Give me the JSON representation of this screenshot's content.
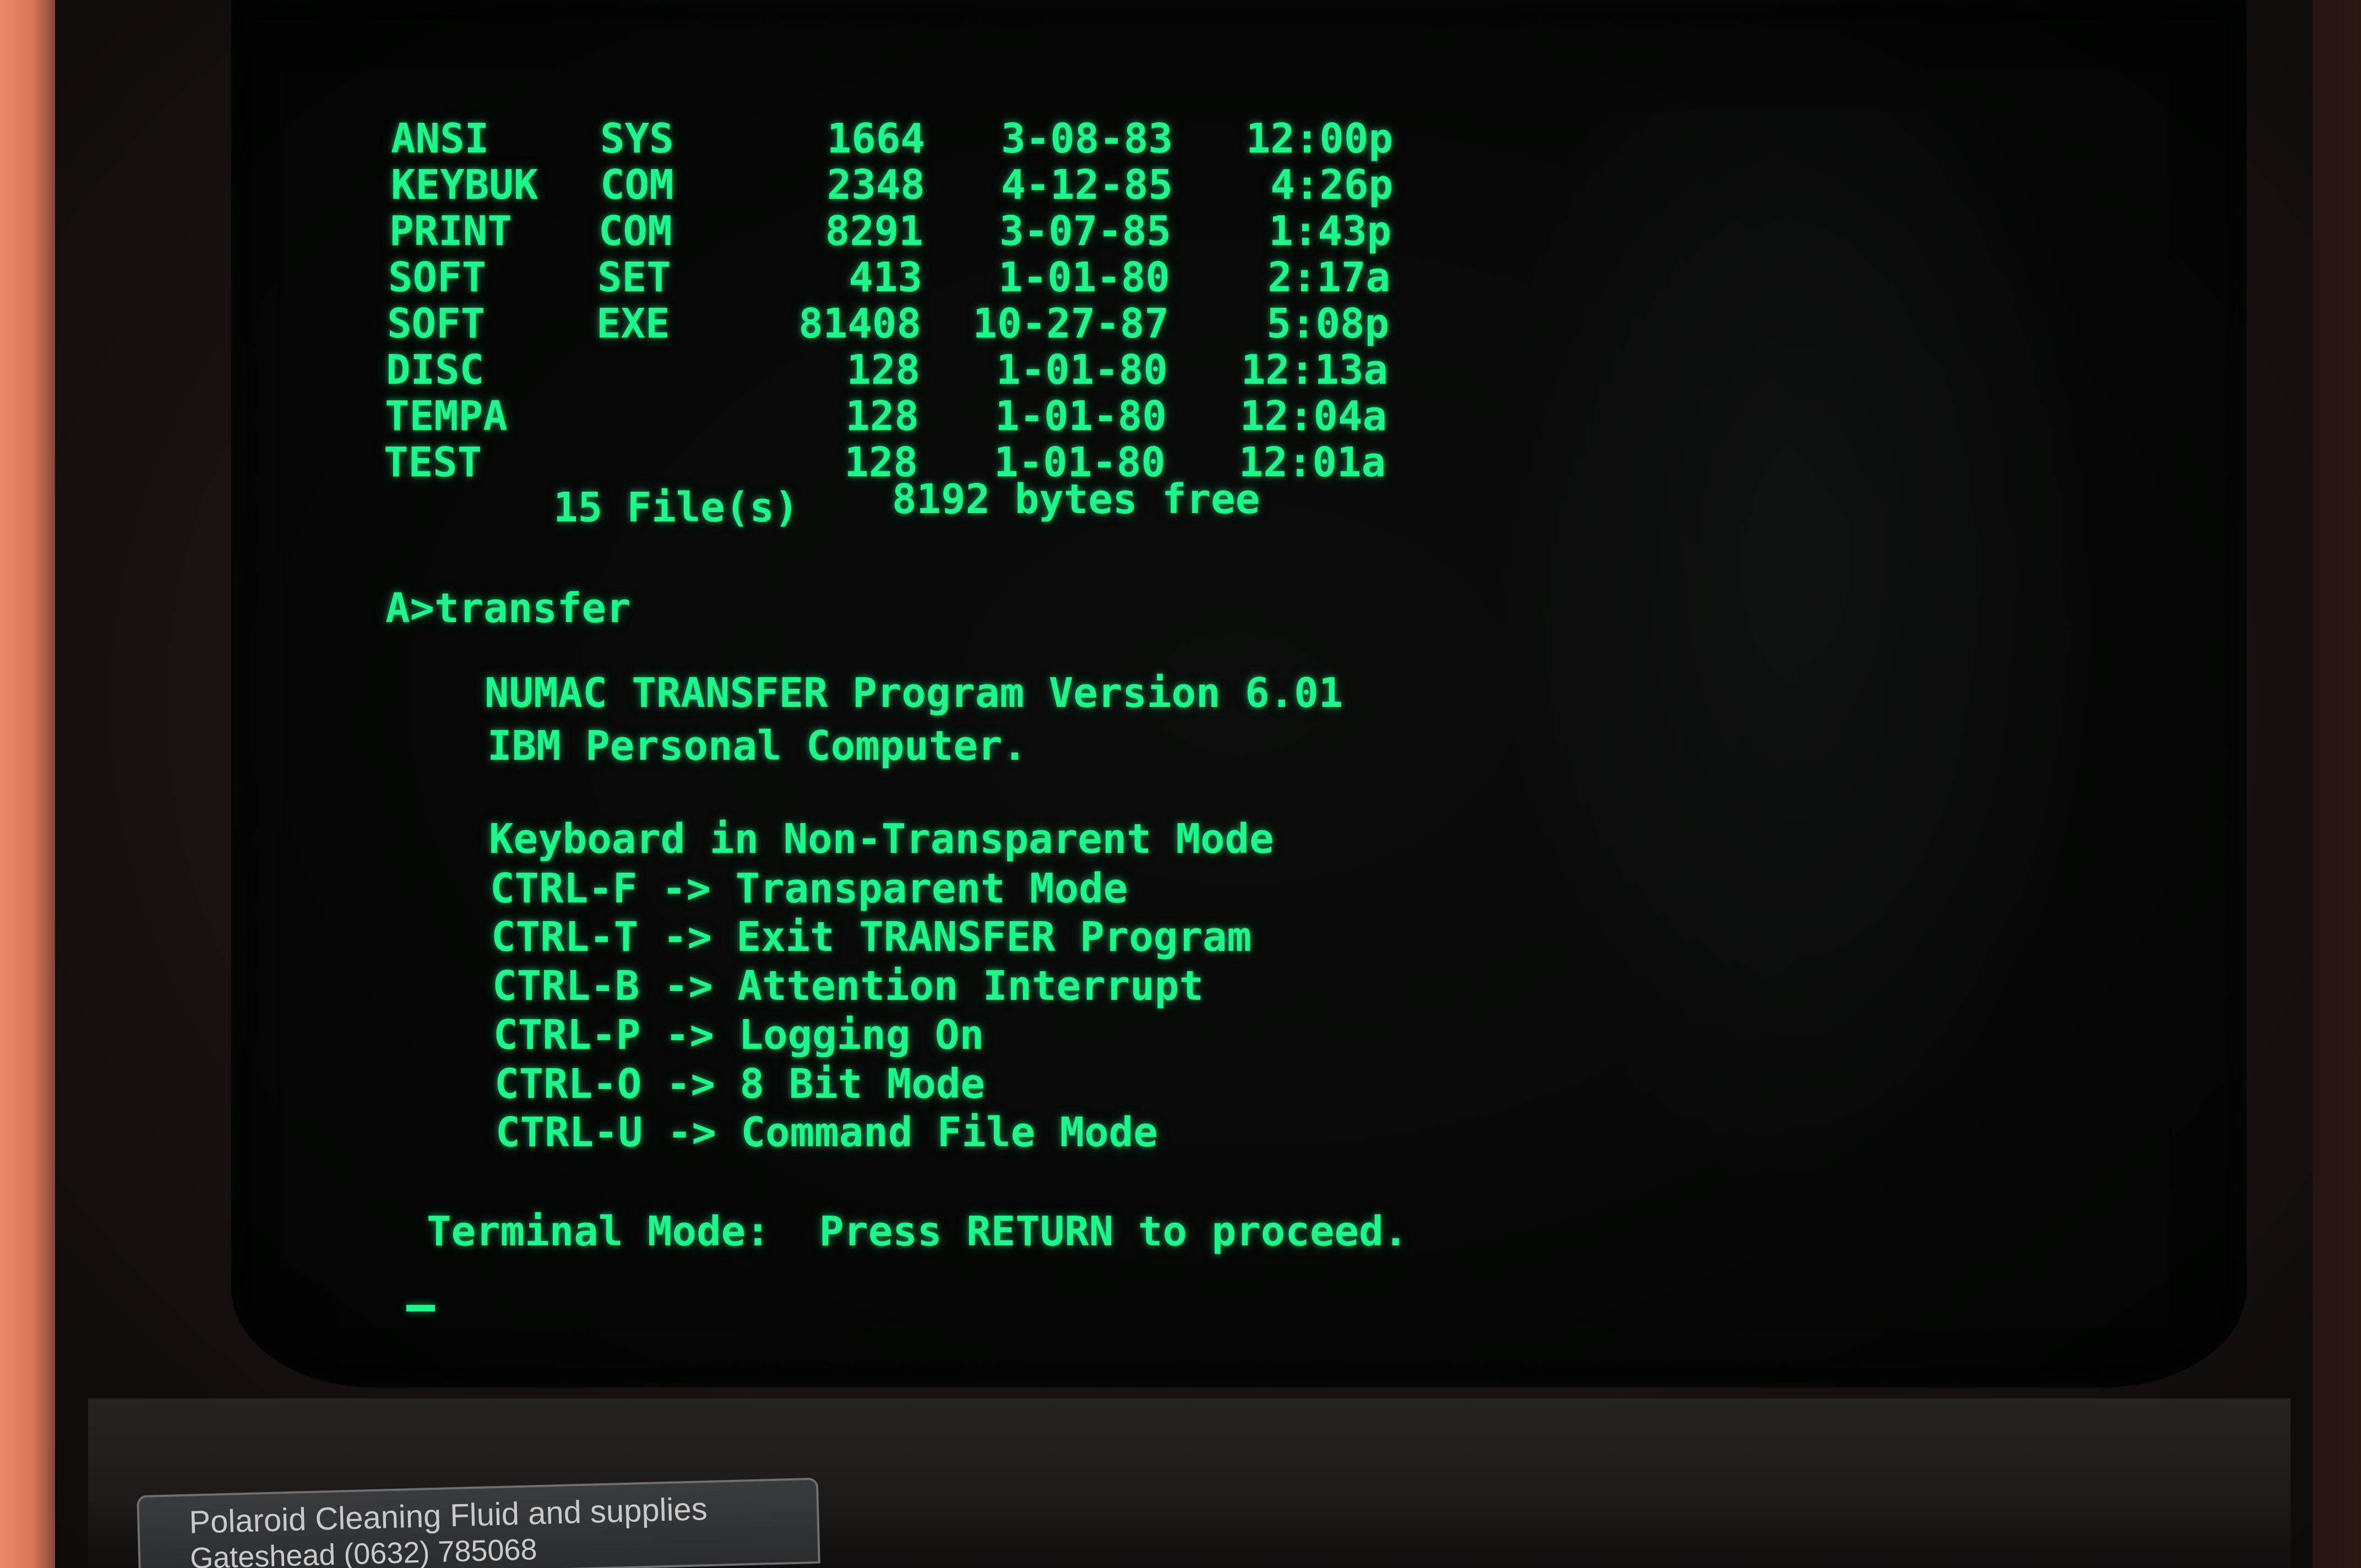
{
  "directory": {
    "rows": [
      {
        "name": "ANSI",
        "ext": "SYS",
        "size": "1664",
        "date": "3-08-83",
        "time": "12:00p"
      },
      {
        "name": "KEYBUK",
        "ext": "COM",
        "size": "2348",
        "date": "4-12-85",
        "time": "4:26p"
      },
      {
        "name": "PRINT",
        "ext": "COM",
        "size": "8291",
        "date": "3-07-85",
        "time": "1:43p"
      },
      {
        "name": "SOFT",
        "ext": "SET",
        "size": "413",
        "date": "1-01-80",
        "time": "2:17a"
      },
      {
        "name": "SOFT",
        "ext": "EXE",
        "size": "81408",
        "date": "10-27-87",
        "time": "5:08p"
      },
      {
        "name": "DISC",
        "ext": "",
        "size": "128",
        "date": "1-01-80",
        "time": "12:13a"
      },
      {
        "name": "TEMPA",
        "ext": "",
        "size": "128",
        "date": "1-01-80",
        "time": "12:04a"
      },
      {
        "name": "TEST",
        "ext": "",
        "size": "128",
        "date": "1-01-80",
        "time": "12:01a"
      }
    ],
    "file_count": "15 File(s)",
    "bytes_free": "8192 bytes free"
  },
  "prompt": {
    "command": "A>transfer"
  },
  "program": {
    "title": "NUMAC TRANSFER Program Version 6.01",
    "platform": "IBM Personal Computer."
  },
  "keyboard": {
    "mode_line": "Keyboard in Non-Transparent Mode",
    "commands": [
      "CTRL-F -> Transparent Mode",
      "CTRL-T -> Exit TRANSFER Program",
      "CTRL-B -> Attention Interrupt",
      "CTRL-P -> Logging On",
      "CTRL-O -> 8 Bit Mode",
      "CTRL-U -> Command File Mode"
    ]
  },
  "status": {
    "terminal_mode": "Terminal Mode:  Press RETURN to proceed."
  },
  "bezel_label": {
    "line1": "Polaroid Cleaning Fluid and supplies",
    "line2": "Gateshead (0632) 785068"
  },
  "colors": {
    "phosphor": "#1ef58a",
    "screen": "#070807"
  }
}
